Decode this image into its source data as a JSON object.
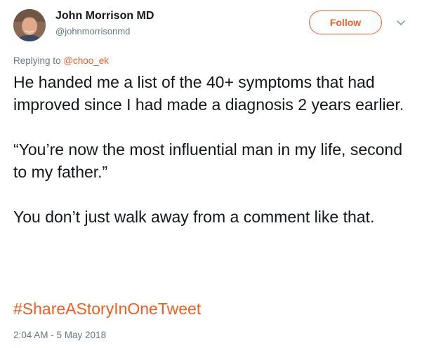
{
  "author": {
    "name": "John Morrison MD",
    "handle": "@johnmorrisonmd",
    "avatar_icon": "profile-photo"
  },
  "follow_button": {
    "label": "Follow"
  },
  "menu": {
    "icon": "chevron-down-icon"
  },
  "reply": {
    "prefix": "Replying to",
    "mention": "@choo_ek"
  },
  "tweet": {
    "paragraphs": [
      "He handed me a list of the 40+ symptoms that had improved since I had made a diagnosis 2 years earlier.",
      "“You’re now the most influential man in my life, second to my father.”",
      "You don’t just walk away from a comment like that."
    ],
    "hashtag": "#ShareAStoryInOneTweet",
    "timestamp": "2:04 AM - 5 May 2018"
  },
  "colors": {
    "accent": "#f45d22",
    "text": "#14171a",
    "secondary": "#657786"
  }
}
